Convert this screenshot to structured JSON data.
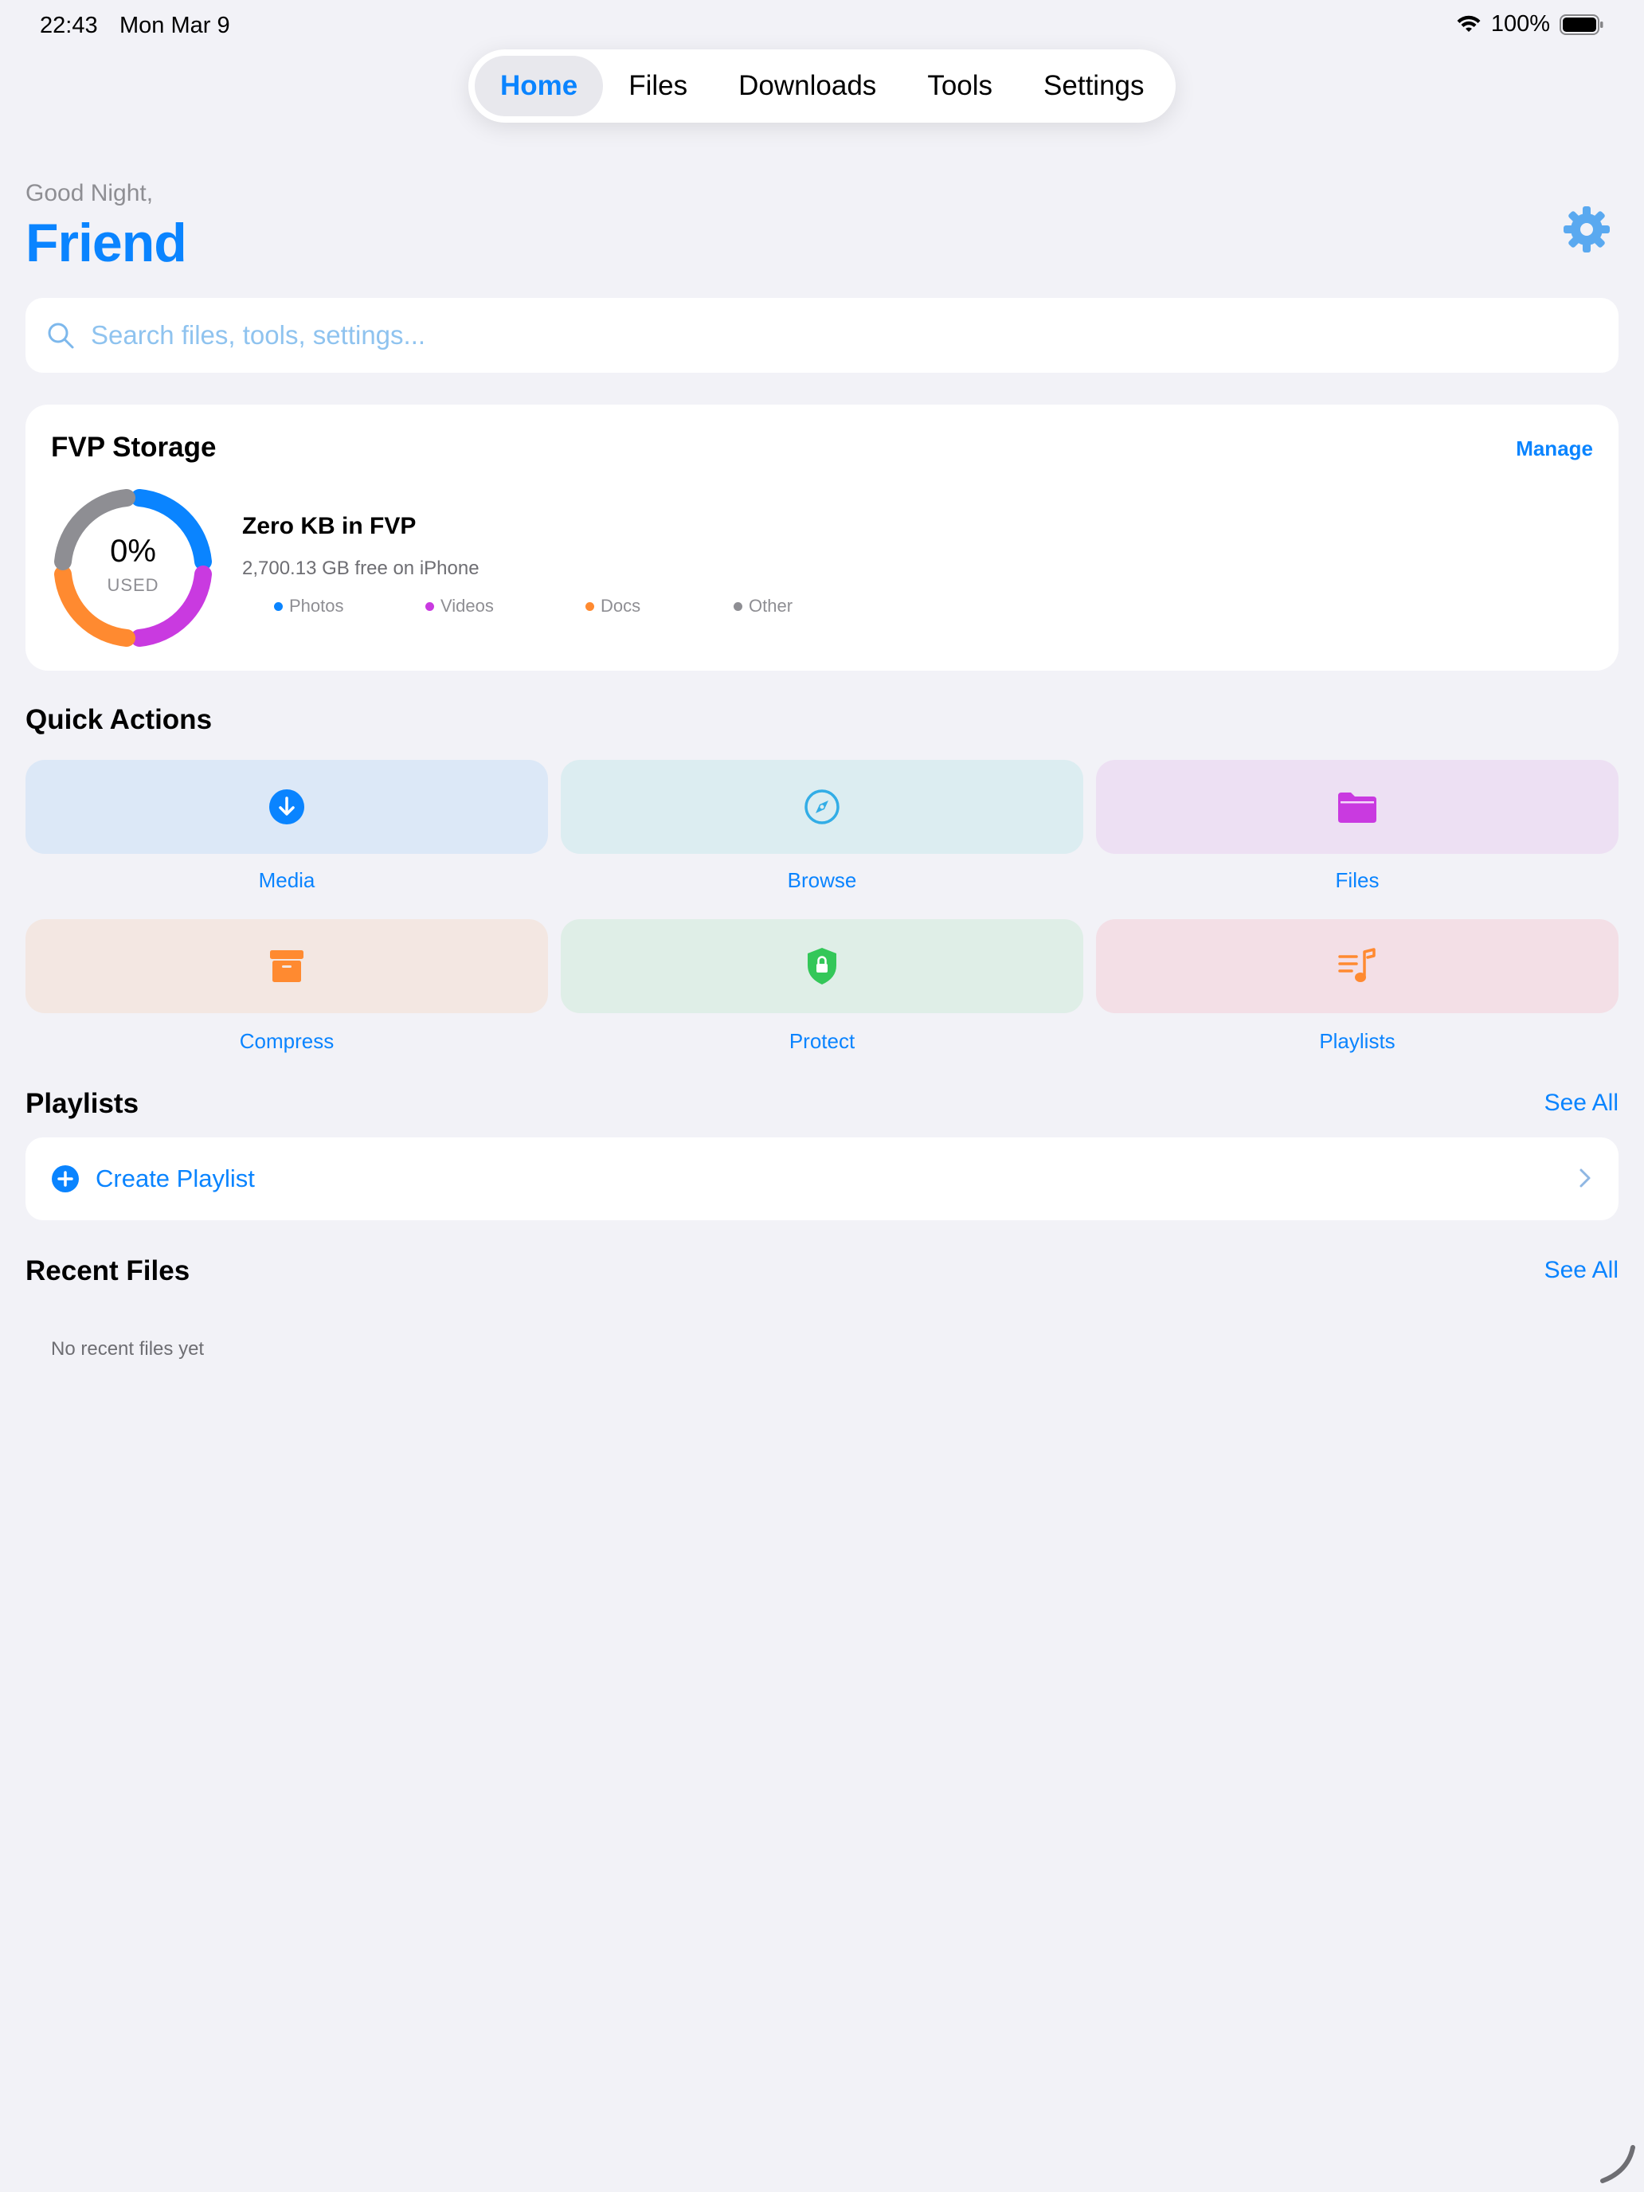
{
  "status_bar": {
    "time": "22:43",
    "date": "Mon Mar 9",
    "battery": "100%"
  },
  "tabs": [
    {
      "label": "Home",
      "active": true
    },
    {
      "label": "Files",
      "active": false
    },
    {
      "label": "Downloads",
      "active": false
    },
    {
      "label": "Tools",
      "active": false
    },
    {
      "label": "Settings",
      "active": false
    }
  ],
  "header": {
    "greeting": "Good Night,",
    "name": "Friend",
    "settings_icon": "gear-icon"
  },
  "search": {
    "placeholder": "Search files, tools, settings...",
    "value": ""
  },
  "storage": {
    "title": "FVP Storage",
    "manage_label": "Manage",
    "percent": "0%",
    "used_label": "USED",
    "headline": "Zero KB in FVP",
    "free_text": "2,700.13 GB free on iPhone",
    "legend": [
      {
        "label": "Photos",
        "color": "#0a84ff"
      },
      {
        "label": "Videos",
        "color": "#c93ae0"
      },
      {
        "label": "Docs",
        "color": "#ff8a30"
      },
      {
        "label": "Other",
        "color": "#8e8e93"
      }
    ]
  },
  "quick_actions": {
    "title": "Quick Actions",
    "items": [
      {
        "label": "Media",
        "icon": "download-circle-icon",
        "bg": "#dce8f7",
        "color": "#0a84ff"
      },
      {
        "label": "Browse",
        "icon": "compass-icon",
        "bg": "#dcedf1",
        "color": "#32ade6"
      },
      {
        "label": "Files",
        "icon": "folder-icon",
        "bg": "#ede0f3",
        "color": "#c93ae0"
      },
      {
        "label": "Compress",
        "icon": "archive-box-icon",
        "bg": "#f3e7e2",
        "color": "#ff8a30"
      },
      {
        "label": "Protect",
        "icon": "lock-shield-icon",
        "bg": "#dfeee7",
        "color": "#34c759"
      },
      {
        "label": "Playlists",
        "icon": "music-list-icon",
        "bg": "#f3dfe6",
        "color": "#ff8a30"
      }
    ]
  },
  "playlists": {
    "title": "Playlists",
    "see_all": "See All",
    "create_label": "Create Playlist"
  },
  "recent_files": {
    "title": "Recent Files",
    "see_all": "See All",
    "empty_text": "No recent files yet"
  }
}
